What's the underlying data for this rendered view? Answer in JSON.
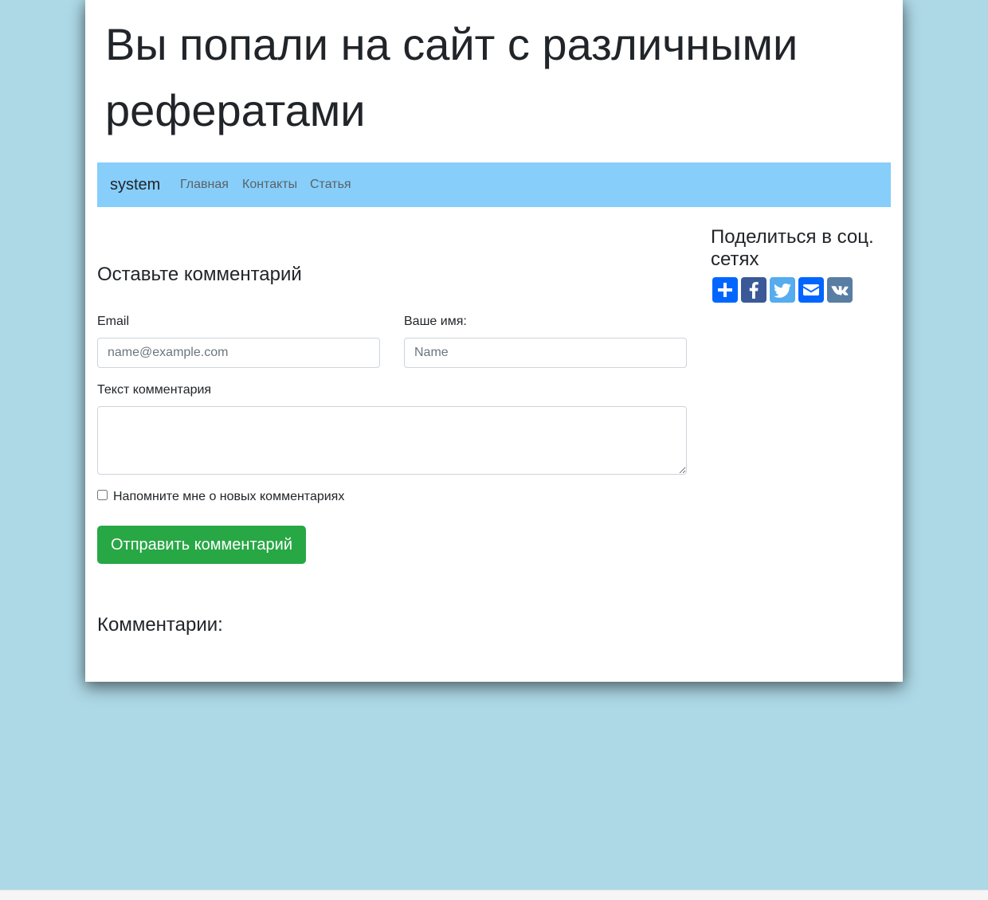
{
  "header": {
    "title": "Вы попали на сайт с различными рефератами"
  },
  "navbar": {
    "brand": "system",
    "links": [
      "Главная",
      "Контакты",
      "Статья"
    ],
    "background": "#87cefa"
  },
  "form": {
    "heading": "Оставьте комментарий",
    "email_label": "Email",
    "email_placeholder": "name@example.com",
    "email_value": "",
    "name_label": "Ваше имя:",
    "name_placeholder": "Name",
    "name_value": "",
    "text_label": "Текст комментария",
    "text_value": "",
    "remind_label": "Напомните мне о новых комментариях",
    "remind_checked": false,
    "submit_label": "Отправить комментарий",
    "submit_color": "#28a745"
  },
  "comments": {
    "heading": "Комментарии:"
  },
  "share": {
    "heading": "Поделиться в соц. сетях",
    "buttons": [
      {
        "icon": "plus-icon",
        "color": "#0166ff"
      },
      {
        "icon": "facebook-icon",
        "color": "#3b5998"
      },
      {
        "icon": "twitter-icon",
        "color": "#55acee"
      },
      {
        "icon": "email-icon",
        "color": "#0166ff"
      },
      {
        "icon": "vk-icon",
        "color": "#587ea3"
      }
    ]
  },
  "colors": {
    "page_background": "#add8e6",
    "container_background": "#ffffff"
  }
}
